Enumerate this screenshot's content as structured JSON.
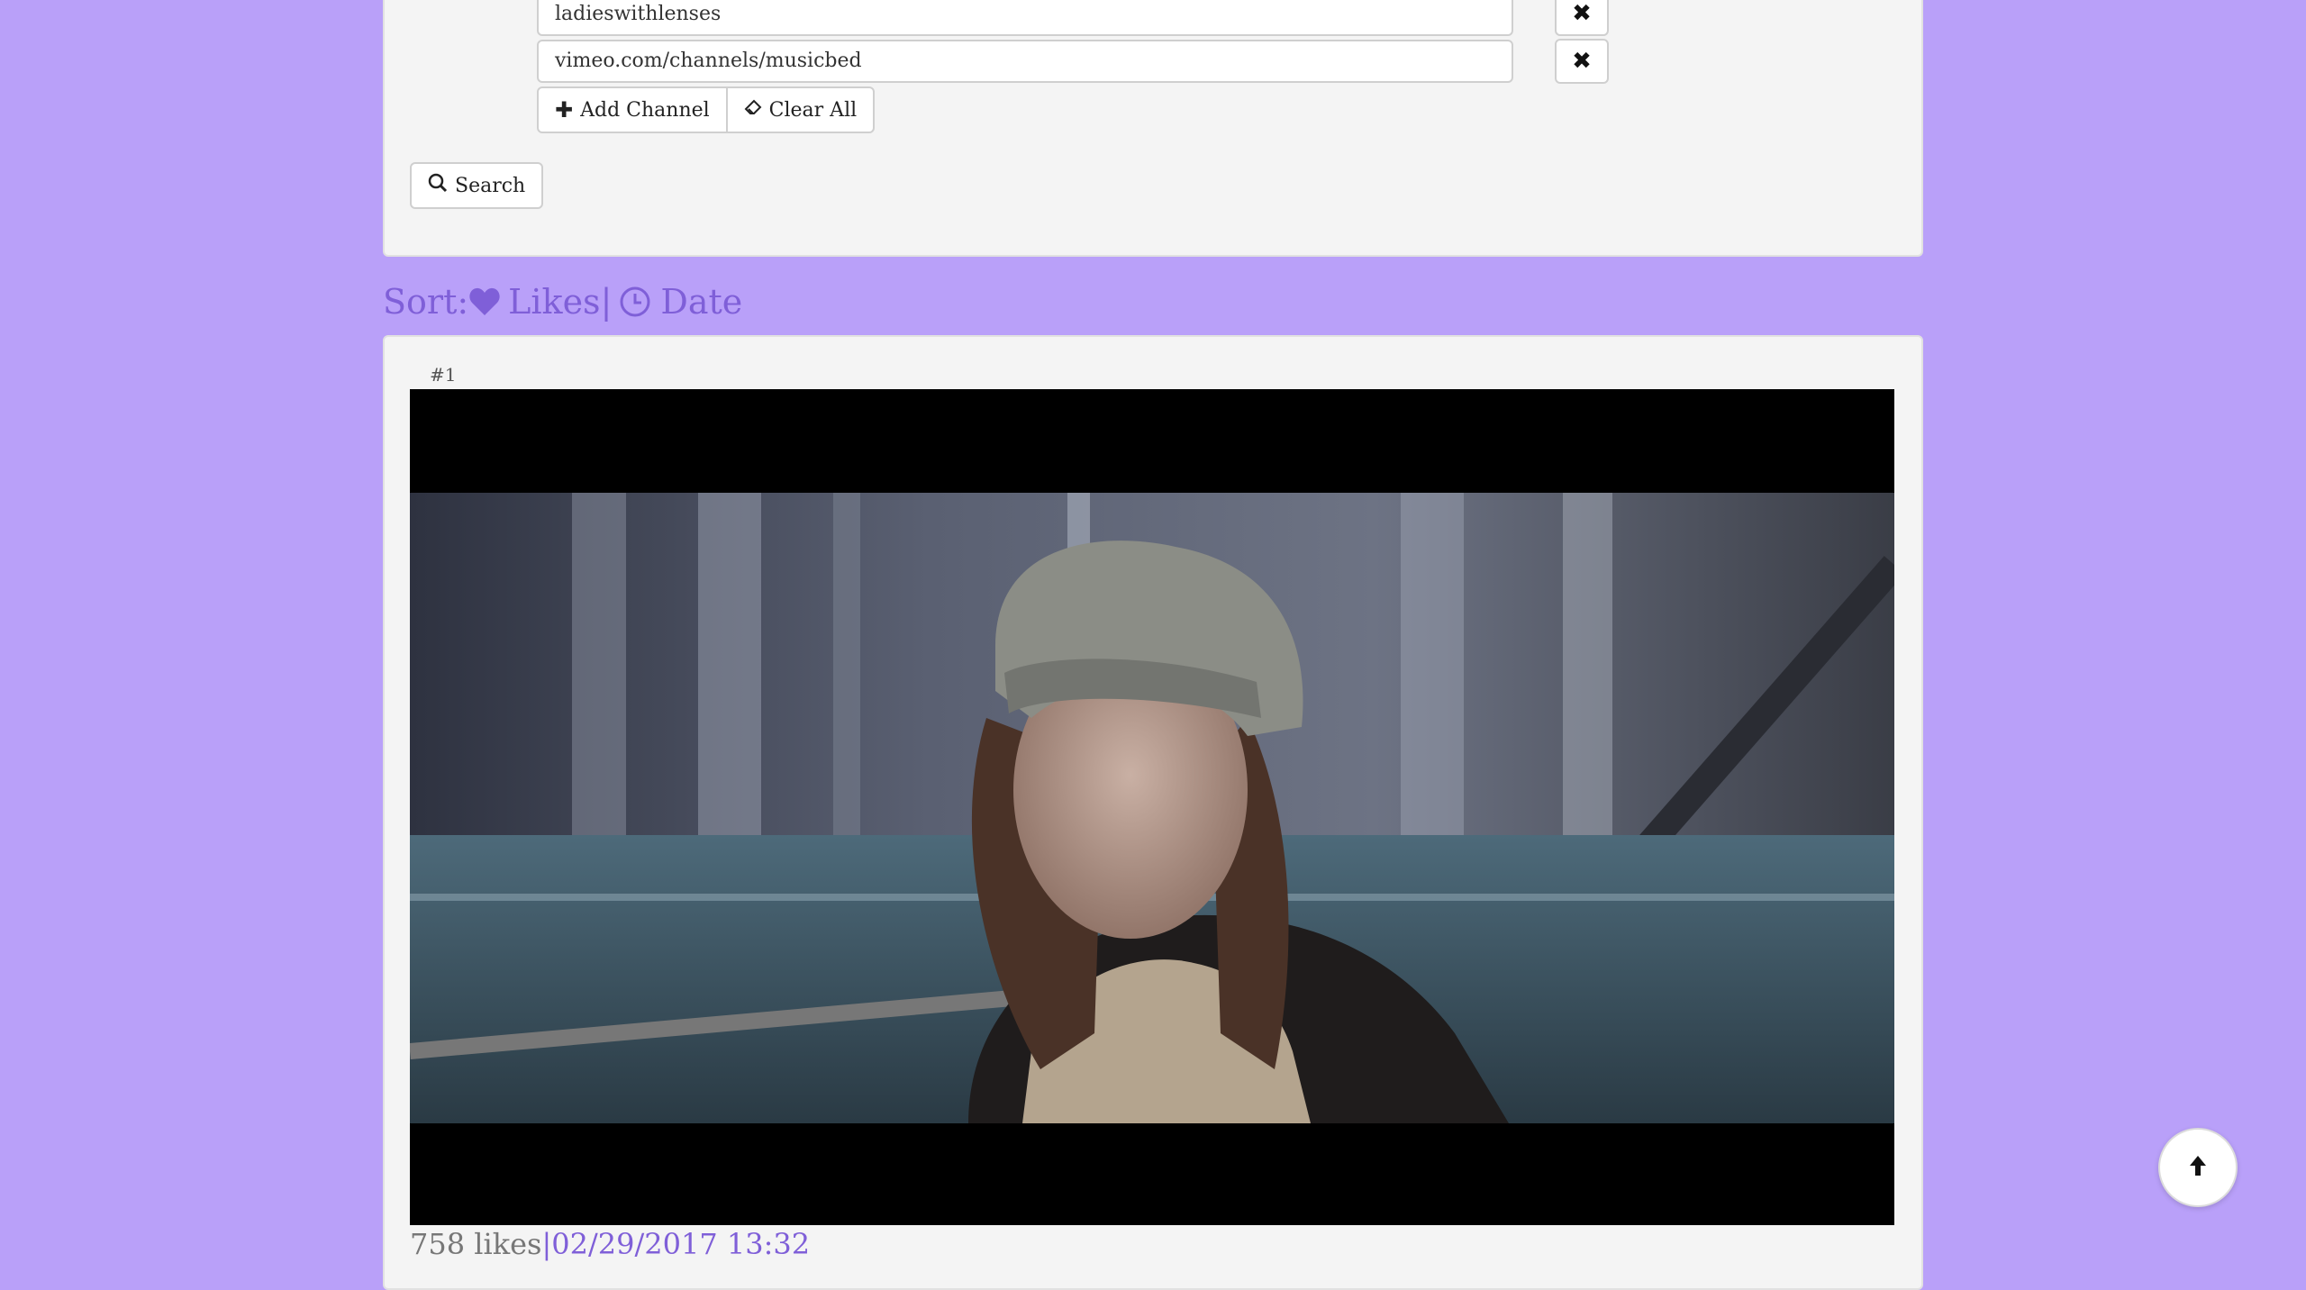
{
  "channels": [
    {
      "value": "ladieswithlenses"
    },
    {
      "value": "vimeo.com/channels/musicbed"
    }
  ],
  "buttons": {
    "add_channel": "Add Channel",
    "clear_all": "Clear All",
    "search": "Search"
  },
  "sort": {
    "label": "Sort:",
    "likes": "Likes",
    "separator": "|",
    "date": "Date"
  },
  "results": [
    {
      "rank": "#1",
      "likes": "758 likes",
      "separator": "|",
      "date": "02/29/2017 13:32"
    }
  ],
  "colors": {
    "background": "#b9a0f9",
    "accent": "#7f5fd8",
    "panel": "#f4f4f4"
  },
  "icons": {
    "remove": "close-icon",
    "add": "plus-icon",
    "clear": "eraser-icon",
    "search": "search-icon",
    "likes": "heart-icon",
    "date": "clock-icon",
    "scroll_top": "arrow-up-icon"
  }
}
